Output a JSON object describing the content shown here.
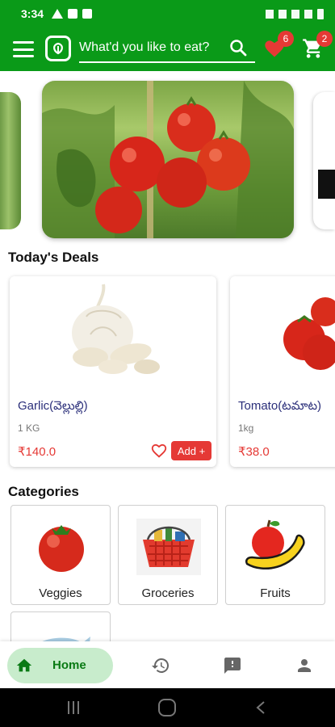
{
  "status_bar": {
    "time": "3:34"
  },
  "app_bar": {
    "search_placeholder": "What'd you like to eat?",
    "favorites_count": "6",
    "cart_count": "2"
  },
  "banner": {
    "subject": "tomatoes-on-vine-image"
  },
  "deals": {
    "title": "Today's Deals",
    "items": [
      {
        "name": "Garlic(వెల్లుల్లి)",
        "qty": "1 KG",
        "price": "₹140.0",
        "add_label": "Add +"
      },
      {
        "name": "Tomato(టమాట)",
        "qty": "1kg",
        "price": "₹38.0"
      }
    ]
  },
  "categories": {
    "title": "Categories",
    "items": [
      {
        "label": "Veggies"
      },
      {
        "label": "Groceries"
      },
      {
        "label": "Fruits"
      }
    ]
  },
  "bottom_nav": {
    "home_label": "Home",
    "items": [
      "home-icon",
      "history-icon",
      "feedback-icon",
      "profile-icon"
    ]
  },
  "colors": {
    "primary": "#0a9a18",
    "accent": "#e53935",
    "nav_active_bg": "#c8eccc"
  }
}
